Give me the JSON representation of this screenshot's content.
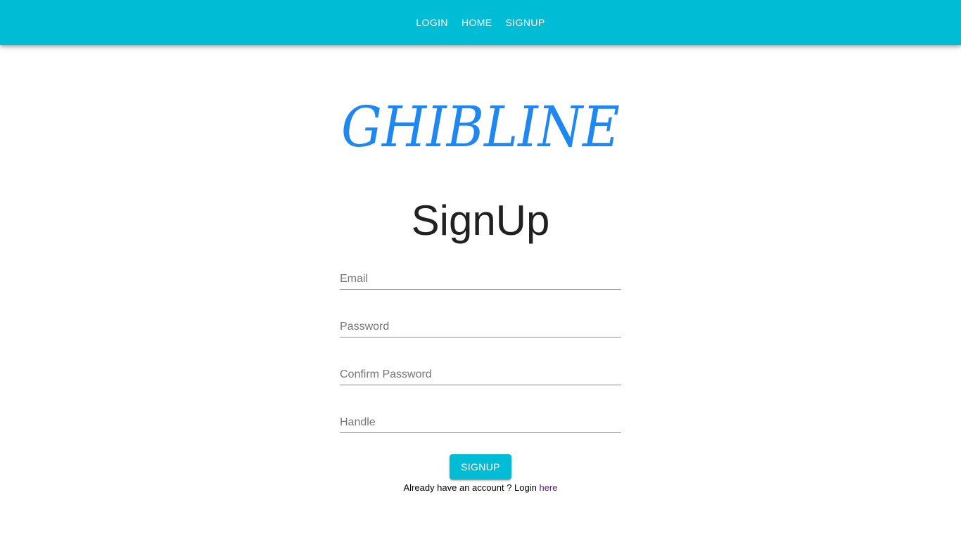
{
  "nav": {
    "items": [
      {
        "label": "LOGIN"
      },
      {
        "label": "HOME"
      },
      {
        "label": "SIGNUP"
      }
    ]
  },
  "logo": {
    "text": "GHIBLINE",
    "color": "#1e88f0"
  },
  "colors": {
    "appbar": "#00bcd4",
    "accent": "#00bcd4",
    "link": "#551a8b"
  },
  "form": {
    "title": "SignUp",
    "fields": {
      "email": {
        "placeholder": "Email",
        "value": ""
      },
      "password": {
        "placeholder": "Password",
        "value": ""
      },
      "confirm_password": {
        "placeholder": "Confirm Password",
        "value": ""
      },
      "handle": {
        "placeholder": "Handle",
        "value": ""
      }
    },
    "submit_label": "SIGNUP",
    "login_prompt": "Already have an account ? Login",
    "login_link": "here"
  }
}
